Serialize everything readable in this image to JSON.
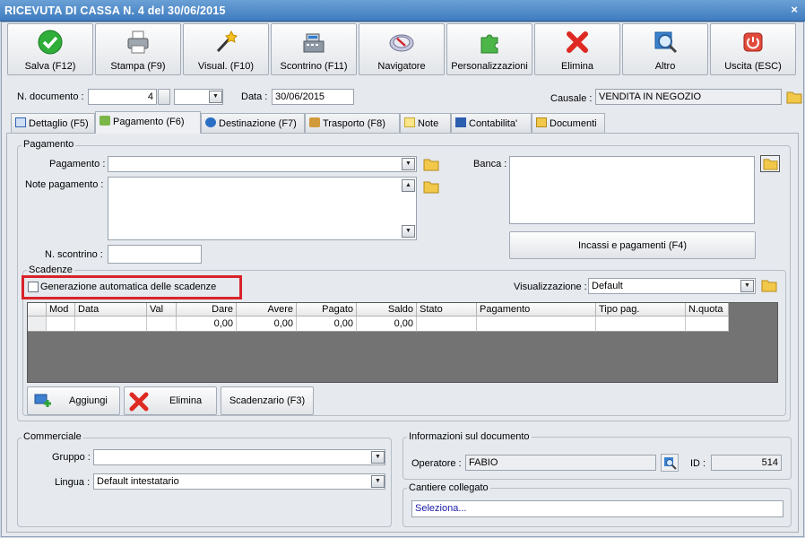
{
  "window": {
    "title": "RICEVUTA DI CASSA N. 4 del 30/06/2015",
    "close": "×"
  },
  "toolbar": [
    {
      "label": "Salva (F12)",
      "icon": "check-icon"
    },
    {
      "label": "Stampa (F9)",
      "icon": "printer-icon"
    },
    {
      "label": "Visual. (F10)",
      "icon": "magic-wand-icon"
    },
    {
      "label": "Scontrino (F11)",
      "icon": "cash-register-icon"
    },
    {
      "label": "Navigatore",
      "icon": "compass-icon"
    },
    {
      "label": "Personalizzazioni",
      "icon": "puzzle-icon"
    },
    {
      "label": "Elimina",
      "icon": "delete-x-icon"
    },
    {
      "label": "Altro",
      "icon": "magnifier-icon"
    },
    {
      "label": "Uscita (ESC)",
      "icon": "power-icon"
    }
  ],
  "header": {
    "ndoc_label": "N. documento :",
    "ndoc_value": "4",
    "data_label": "Data :",
    "data_value": "30/06/2015",
    "causale_label": "Causale :",
    "causale_value": "VENDITA IN NEGOZIO"
  },
  "tabs": [
    {
      "label": "Dettaglio (F5)"
    },
    {
      "label": "Pagamento (F6)"
    },
    {
      "label": "Destinazione (F7)"
    },
    {
      "label": "Trasporto (F8)"
    },
    {
      "label": "Note"
    },
    {
      "label": "Contabilita'"
    },
    {
      "label": "Documenti"
    }
  ],
  "pagamento": {
    "group_title": "Pagamento",
    "pagamento_label": "Pagamento :",
    "pagamento_value": "",
    "note_label": "Note pagamento :",
    "note_value": "",
    "scontrino_label": "N. scontrino :",
    "scontrino_value": "",
    "banca_label": "Banca :",
    "banca_value": "",
    "incassi_button": "Incassi e pagamenti (F4)"
  },
  "scadenze": {
    "group_title": "Scadenze",
    "auto_checkbox_label": "Generazione automatica delle scadenze",
    "auto_checked": false,
    "visual_label": "Visualizzazione :",
    "visual_value": "Default",
    "columns": [
      "Mod",
      "Data",
      "Val",
      "Dare",
      "Avere",
      "Pagato",
      "Saldo",
      "Stato",
      "Pagamento",
      "Tipo pag.",
      "N.quota"
    ],
    "row": {
      "mod": "",
      "data": "",
      "val": "",
      "dare": "0,00",
      "avere": "0,00",
      "pagato": "0,00",
      "saldo": "0,00",
      "stato": "",
      "pagamento": "",
      "tipo": "",
      "nquota": ""
    },
    "buttons": {
      "add": "Aggiungi",
      "delete": "Elimina",
      "scadenzario": "Scadenzario (F3)"
    }
  },
  "commerciale": {
    "group_title": "Commerciale",
    "gruppo_label": "Gruppo :",
    "gruppo_value": "",
    "lingua_label": "Lingua :",
    "lingua_value": "Default intestatario"
  },
  "info": {
    "group_title": "Informazioni sul documento",
    "operatore_label": "Operatore :",
    "operatore_value": "FABIO",
    "id_label": "ID :",
    "id_value": "514"
  },
  "cantiere": {
    "group_title": "Cantiere collegato",
    "value": "Seleziona..."
  },
  "colors": {
    "title_bar": "#4a87c8",
    "highlight_box": "#d9232a",
    "link_text": "#1a1aa6"
  }
}
